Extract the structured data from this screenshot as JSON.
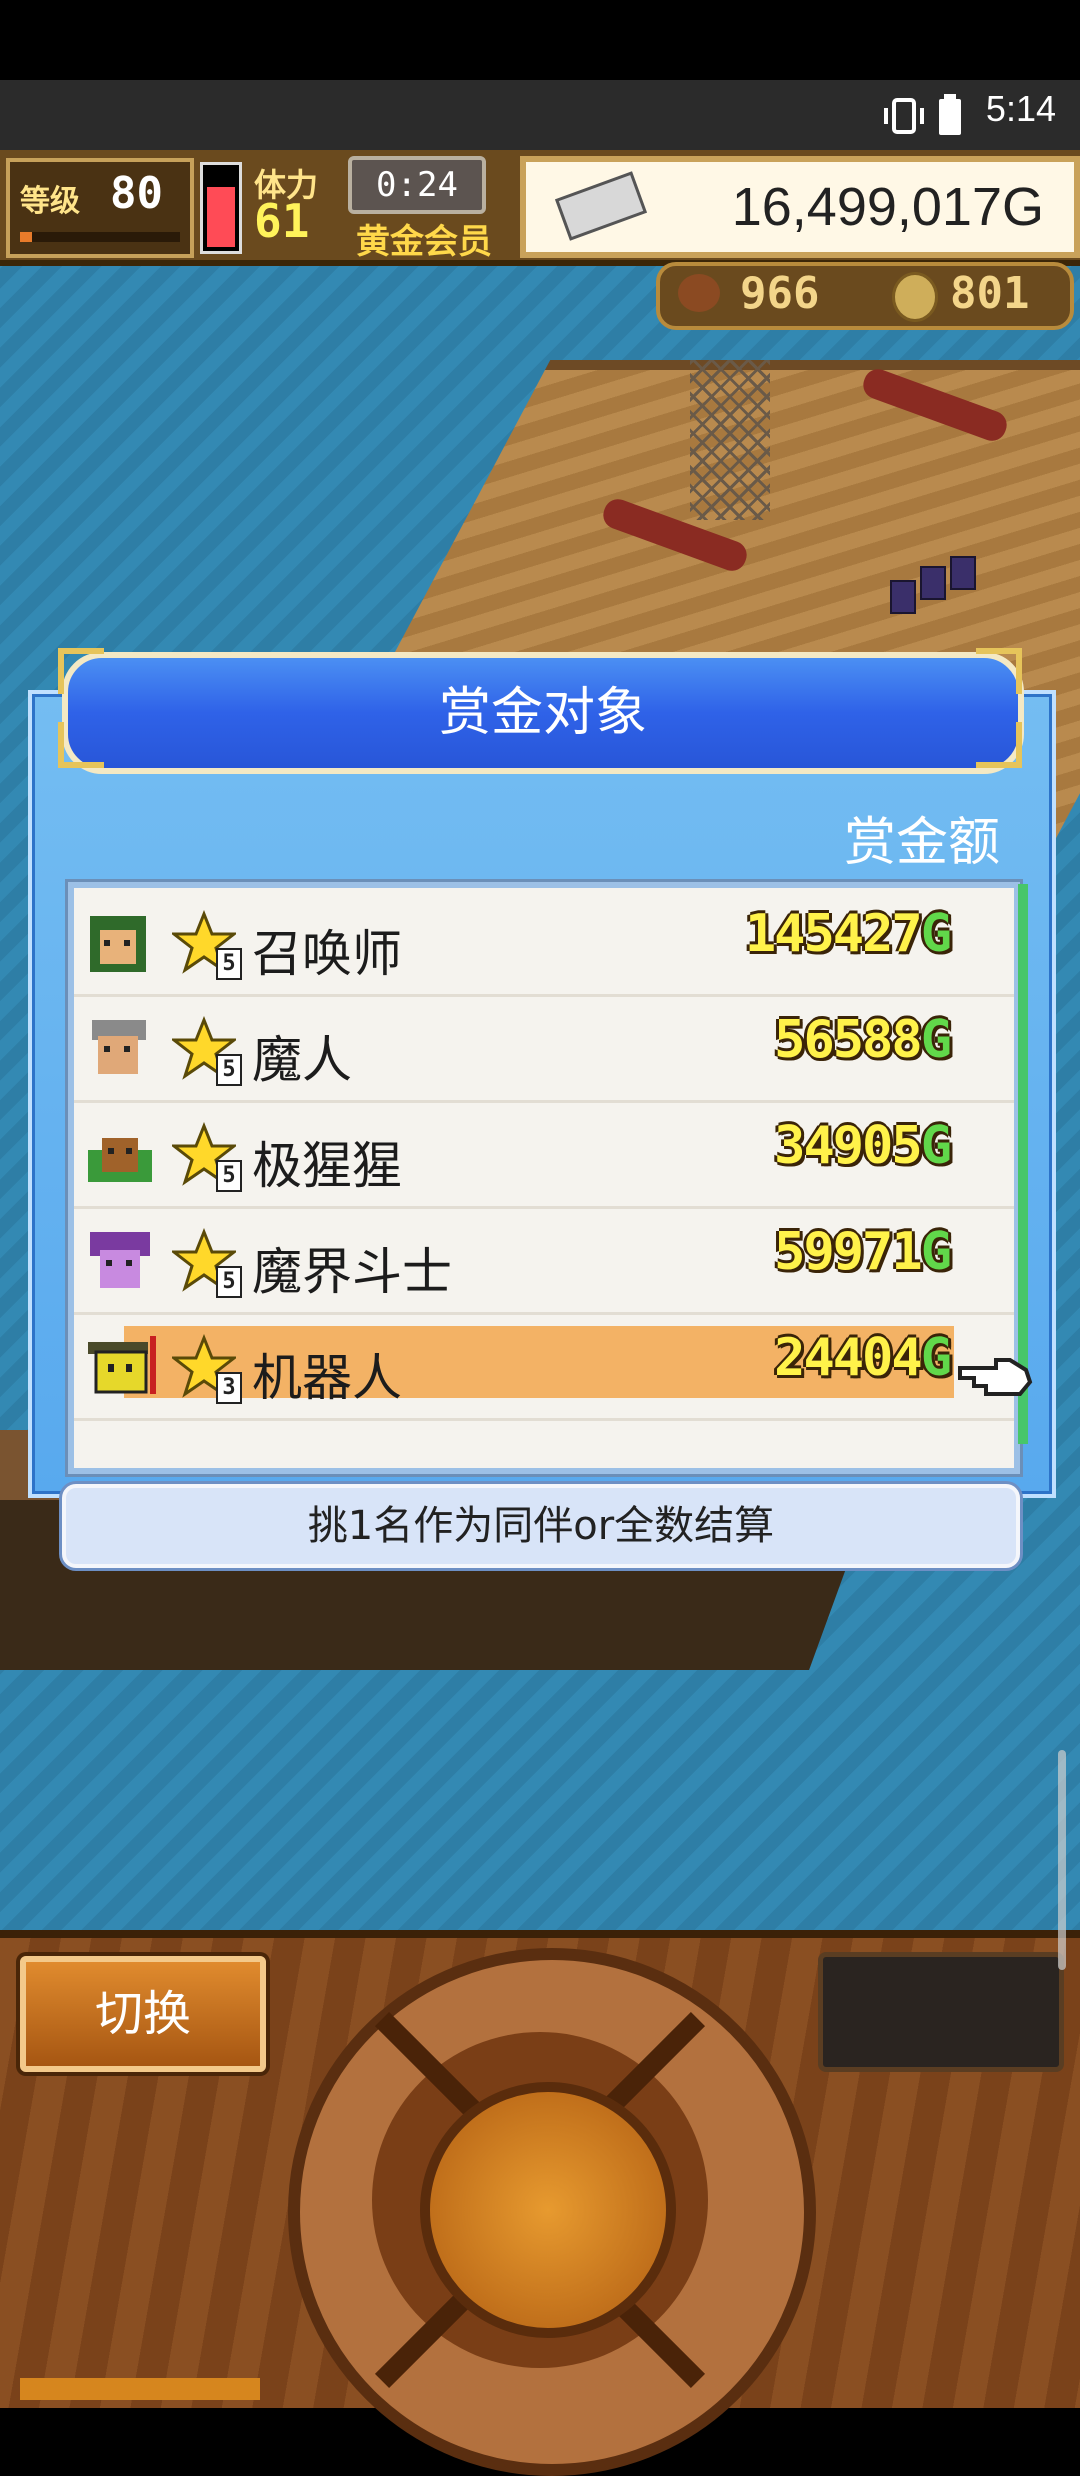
{
  "status_bar": {
    "time": "5:14"
  },
  "hud": {
    "level_label": "等级",
    "level_value": "80",
    "stamina_label": "体力",
    "stamina_value": "61",
    "timer": "0:24",
    "membership": "黄金会员",
    "money": "16,499,017G",
    "food_count": "966",
    "coin_count": "801"
  },
  "dialog": {
    "title": "赏金对象",
    "column_header": "赏金额",
    "rows": [
      {
        "name": "召唤师",
        "rank": "5",
        "reward": "145427",
        "unit": "G",
        "selected": false
      },
      {
        "name": "魔人",
        "rank": "5",
        "reward": "56588",
        "unit": "G",
        "selected": false
      },
      {
        "name": "极猩猩",
        "rank": "5",
        "reward": "34905",
        "unit": "G",
        "selected": false
      },
      {
        "name": "魔界斗士",
        "rank": "5",
        "reward": "59971",
        "unit": "G",
        "selected": false
      },
      {
        "name": "机器人",
        "rank": "3",
        "reward": "24404",
        "unit": "G",
        "selected": true
      }
    ],
    "hint": "挑1名作为同伴or全数结算"
  },
  "controls": {
    "switch_label": "切换"
  },
  "colors": {
    "selected_row": "#f3b265",
    "dialog_title": "#2f62e8",
    "reward_text": "#fff24a",
    "reward_unit": "#61d84a"
  }
}
